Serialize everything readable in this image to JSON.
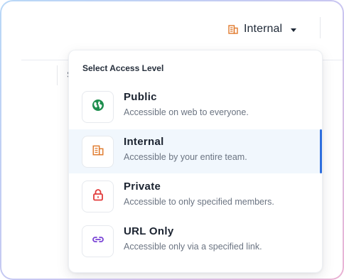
{
  "toolbar": {
    "access_label": "Internal"
  },
  "background": {
    "partial_char": "S"
  },
  "dropdown": {
    "title": "Select Access Level",
    "selected": "internal",
    "options": [
      {
        "key": "public",
        "label": "Public",
        "description": "Accessible on web to everyone.",
        "icon": "globe-icon",
        "color": "#1e8e4e"
      },
      {
        "key": "internal",
        "label": "Internal",
        "description": "Accessible by your entire team.",
        "icon": "building-icon",
        "color": "#e07b2e"
      },
      {
        "key": "private",
        "label": "Private",
        "description": "Accessible to only specified members.",
        "icon": "lock-icon",
        "color": "#e23b3b"
      },
      {
        "key": "url_only",
        "label": "URL Only",
        "description": "Accessible only via a specified link.",
        "icon": "link-icon",
        "color": "#7a44d6"
      }
    ]
  },
  "colors": {
    "selected_bg": "#f1f7fd",
    "selected_bar": "#2f6fde",
    "frame_gradient_start": "#b9d8f7",
    "frame_gradient_end": "#eab3d4"
  }
}
